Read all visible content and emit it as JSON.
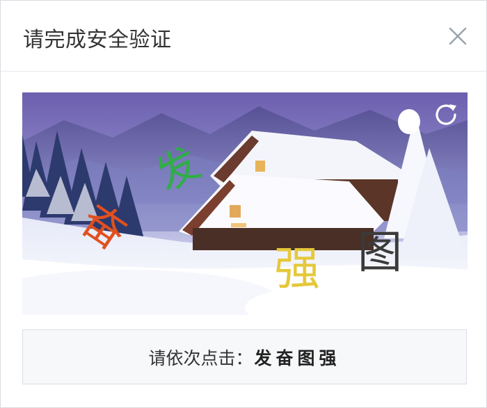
{
  "dialog": {
    "title": "请完成安全验证"
  },
  "captcha": {
    "refresh_icon": "refresh-icon",
    "characters": [
      {
        "text": "发",
        "color": "#2fae46"
      },
      {
        "text": "奋",
        "color": "#e0501e"
      },
      {
        "text": "强",
        "color": "#e5c83a"
      },
      {
        "text": "图",
        "color": "#3a3a3a"
      }
    ]
  },
  "instruction": {
    "prompt": "请依次点击：",
    "targets": "发奋图强"
  }
}
